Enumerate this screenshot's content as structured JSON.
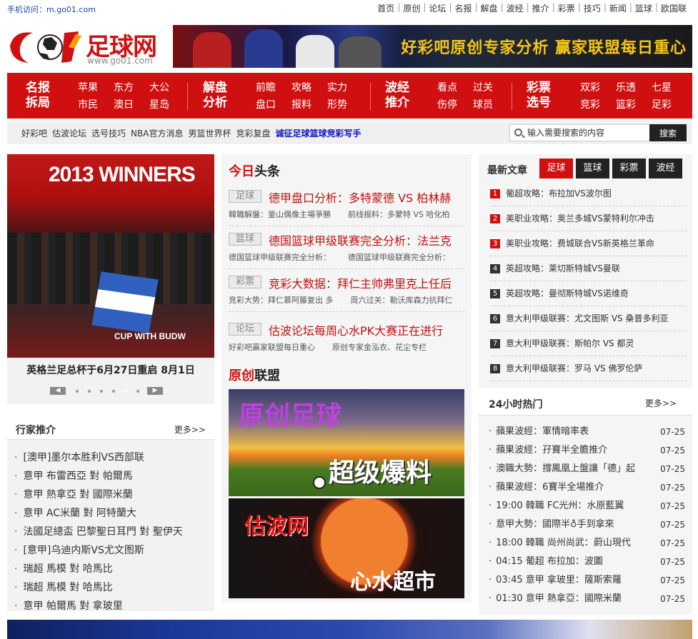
{
  "top": {
    "mobile_label": "手机访问：",
    "mobile_url": "m.go01.com",
    "nav": [
      "首页",
      "原创",
      "论坛",
      "名报",
      "解盘",
      "波经",
      "推介",
      "彩票",
      "技巧",
      "新闻",
      "篮球",
      "欧国联"
    ]
  },
  "logo": {
    "brand": "足球网",
    "url": "www.go01.com"
  },
  "banner": {
    "text": "好彩吧原创专家分析 赢家联盟每日重心"
  },
  "rednav": [
    {
      "head": "名报拆局",
      "items": [
        "苹果",
        "东方",
        "大公",
        "市民",
        "澳日",
        "星岛"
      ]
    },
    {
      "head": "解盘分析",
      "items": [
        "前瞻",
        "攻略",
        "实力",
        "盘口",
        "报料",
        "形势"
      ]
    },
    {
      "head": "波经推介",
      "items": [
        "看点",
        "过关",
        "伤停",
        "球员"
      ]
    },
    {
      "head": "彩票选号",
      "items": [
        "双彩",
        "乐透",
        "七星",
        "竞彩",
        "篮彩",
        "足彩"
      ]
    }
  ],
  "subnav": {
    "links": [
      "好彩吧",
      "估波论坛",
      "选号技巧",
      "NBA官方消息",
      "男篮世界杯",
      "竞彩复盘"
    ],
    "highlight": "诚征足球篮球竞彩写手"
  },
  "search": {
    "placeholder": "输入需要搜索的内容",
    "button": "搜索"
  },
  "slide": {
    "image_text": "2013 WINNERS",
    "image_text2": "CUP WITH BUDW",
    "caption": "英格兰足总杯于6月27日重启 8月1日"
  },
  "hangjia": {
    "title": "行家推介",
    "more": "更多>>",
    "items": [
      "[澳甲]墨尔本胜利VS西部联",
      "意甲 布雷西亞 對 帕爾馬",
      "意甲 熱拿亞 對 國際米蘭",
      "意甲 AC米蘭 對 阿特蘭大",
      "法國足總盃 巴黎聖日耳門 對 聖伊天",
      "[意甲]乌迪内斯VS尤文图斯",
      "瑞超 馬模 對 哈馬比",
      "瑞超 馬模 對 哈馬比",
      "意甲 帕爾馬 對 拿玻里"
    ]
  },
  "today": {
    "title_red": "今日",
    "title_rest": "头条",
    "news": [
      {
        "tag": "足球",
        "headline": "德甲盘口分析：多特蒙德 VS 柏林赫",
        "subs": [
          "韓職解盤：釜山偶像主場爭勝",
          "前线报料：多蒙特 VS 哈化柏"
        ]
      },
      {
        "tag": "篮球",
        "headline": "德国篮球甲级联赛完全分析：法兰克",
        "subs": [
          "德国篮球甲级联赛完全分析：",
          "德国篮球甲级联赛完全分析："
        ]
      },
      {
        "tag": "彩票",
        "headline": "竞彩大数据：拜仁主帅弗里克上任后",
        "subs": [
          "竞彩大势：拜仁慕阿籐复出 多",
          "周六过关：勒沃库森力抗拜仁"
        ]
      },
      {
        "tag": "论坛",
        "headline": "估波论坛每周心水PK大赛正在进行",
        "subs": [
          "好彩吧赢家联盟每日重心",
          "原创专家金泓衣、花尘专栏"
        ]
      }
    ]
  },
  "yuanchuang": {
    "title_red": "原创",
    "title_rest": "联盟",
    "promo1_a": "原创足球",
    "promo1_b": "超级爆料",
    "promo2_a": "估波网",
    "promo2_b": "心水超市"
  },
  "latest": {
    "title": "最新文章",
    "tabs": [
      "足球",
      "篮球",
      "彩票",
      "波经"
    ],
    "items": [
      {
        "n": "1",
        "text": "葡超攻略：布拉加VS波尔图"
      },
      {
        "n": "2",
        "text": "美职业攻略：奥兰多城VS蒙特利尔冲击"
      },
      {
        "n": "3",
        "text": "美职业攻略：费城联合VS新英格兰革命"
      },
      {
        "n": "4",
        "text": "英超攻略：莱切斯特城VS曼联"
      },
      {
        "n": "5",
        "text": "英超攻略：曼彻斯特城VS诺维奇"
      },
      {
        "n": "6",
        "text": "意大利甲级联赛：尤文图斯 VS 桑普多利亚"
      },
      {
        "n": "7",
        "text": "意大利甲级联赛：斯帕尔 VS 都灵"
      },
      {
        "n": "8",
        "text": "意大利甲级联赛：罗马 VS 佛罗伦萨"
      }
    ]
  },
  "hot24": {
    "title": "24小时热门",
    "more": "更多>>",
    "items": [
      {
        "text": "蘋果波經：軍情暗率表",
        "date": "07-25"
      },
      {
        "text": "蘋果波經：孖寶半全膽推介",
        "date": "07-25"
      },
      {
        "text": "澳職大勢：撐鳳凰上盤讓「德」起",
        "date": "07-25"
      },
      {
        "text": "蘋果波經：6寶半全場推介",
        "date": "07-25"
      },
      {
        "text": "19:00  韓職  FC光州：水原藍翼",
        "date": "07-25"
      },
      {
        "text": "意甲大勢：國際半♁手到拿來",
        "date": "07-25"
      },
      {
        "text": "18:00  韓職  尚州尚武：蔚山現代",
        "date": "07-25"
      },
      {
        "text": "04:15  葡超  布拉加：波圖",
        "date": "07-25"
      },
      {
        "text": "03:45  意甲  拿玻里：薩斯索羅",
        "date": "07-25"
      },
      {
        "text": "01:30  意甲  熱拿亞：國際米蘭",
        "date": "07-25"
      }
    ]
  },
  "colors": {
    "brand_red": "#d01010",
    "dark": "#222222",
    "link_blue": "#1010c0"
  }
}
